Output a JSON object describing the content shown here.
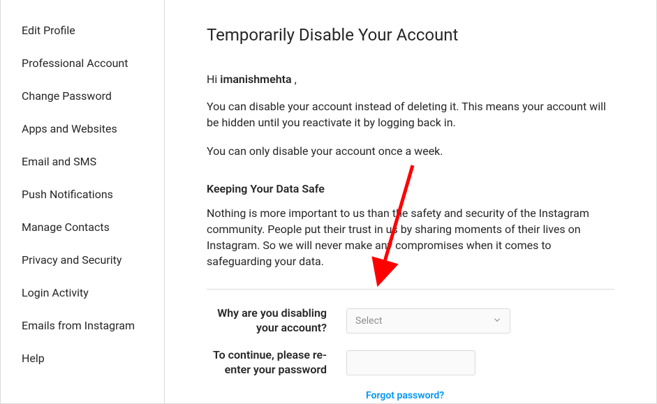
{
  "sidebar": {
    "items": [
      {
        "label": "Edit Profile"
      },
      {
        "label": "Professional Account"
      },
      {
        "label": "Change Password"
      },
      {
        "label": "Apps and Websites"
      },
      {
        "label": "Email and SMS"
      },
      {
        "label": "Push Notifications"
      },
      {
        "label": "Manage Contacts"
      },
      {
        "label": "Privacy and Security"
      },
      {
        "label": "Login Activity"
      },
      {
        "label": "Emails from Instagram"
      },
      {
        "label": "Help"
      }
    ]
  },
  "main": {
    "title": "Temporarily Disable Your Account",
    "greeting_prefix": "Hi ",
    "username": "imanishmehta",
    "greeting_suffix": " ,",
    "para1": "You can disable your account instead of deleting it. This means your account will be hidden until you reactivate it by logging back in.",
    "para2": "You can only disable your account once a week.",
    "section_header": "Keeping Your Data Safe",
    "para3": "Nothing is more important to us than the safety and security of the Instagram community. People put their trust in us by sharing moments of their lives on Instagram. So we will never make any compromises when it comes to safeguarding your data.",
    "reason_label": "Why are you disabling your account?",
    "reason_select_placeholder": "Select",
    "password_label": "To continue, please re-enter your password",
    "forgot_label": "Forgot password?"
  }
}
